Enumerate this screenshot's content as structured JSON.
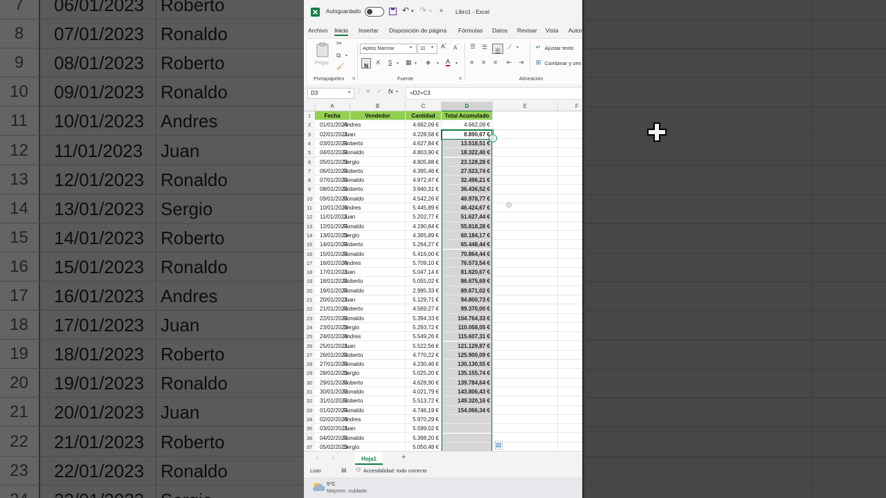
{
  "background": {
    "rows": [
      {
        "n": "7",
        "date": "06/01/2023",
        "name": "Roberto"
      },
      {
        "n": "8",
        "date": "07/01/2023",
        "name": "Ronaldo"
      },
      {
        "n": "9",
        "date": "08/01/2023",
        "name": "Roberto"
      },
      {
        "n": "10",
        "date": "09/01/2023",
        "name": "Ronaldo"
      },
      {
        "n": "11",
        "date": "10/01/2023",
        "name": "Andres"
      },
      {
        "n": "12",
        "date": "11/01/2023",
        "name": "Juan"
      },
      {
        "n": "13",
        "date": "12/01/2023",
        "name": "Ronaldo"
      },
      {
        "n": "14",
        "date": "13/01/2023",
        "name": "Sergio"
      },
      {
        "n": "15",
        "date": "14/01/2023",
        "name": "Roberto"
      },
      {
        "n": "16",
        "date": "15/01/2023",
        "name": "Ronaldo"
      },
      {
        "n": "17",
        "date": "16/01/2023",
        "name": "Andres"
      },
      {
        "n": "18",
        "date": "17/01/2023",
        "name": "Juan"
      },
      {
        "n": "19",
        "date": "18/01/2023",
        "name": "Roberto"
      },
      {
        "n": "20",
        "date": "19/01/2023",
        "name": "Ronaldo"
      },
      {
        "n": "21",
        "date": "20/01/2023",
        "name": "Juan"
      },
      {
        "n": "22",
        "date": "21/01/2023",
        "name": "Roberto"
      },
      {
        "n": "23",
        "date": "22/01/2023",
        "name": "Ronaldo"
      },
      {
        "n": "24",
        "date": "23/01/2023",
        "name": "Sergio"
      }
    ]
  },
  "titlebar": {
    "autosave_label": "Autoguardado",
    "doc_title": "Libro1  -  Excel"
  },
  "tabs": [
    "Archivo",
    "Inicio",
    "Insertar",
    "Disposición de página",
    "Fórmulas",
    "Datos",
    "Revisar",
    "Vista",
    "Autom"
  ],
  "active_tab": "Inicio",
  "ribbon": {
    "paste_label": "Pegar",
    "clipboard_group": "Portapapeles",
    "font_name": "Aptos Narrow",
    "font_size": "11",
    "bold": "N",
    "italic": "K",
    "underline": "S",
    "font_group": "Fuente",
    "wrap_text": "Ajustar texto",
    "merge": "Combinar y cen",
    "alignment_group": "Alineación"
  },
  "formula_bar": {
    "name_box": "D3",
    "fx": "fx",
    "formula": "=D2+C3"
  },
  "columns": [
    "A",
    "B",
    "C",
    "D",
    "E",
    "F"
  ],
  "headers": [
    "Fecha",
    "Vendedor",
    "Cantidad",
    "Total Acumulado"
  ],
  "rows": [
    [
      "01/01/2023",
      "Andres",
      "4.662,09 €",
      "4.662,09 €"
    ],
    [
      "02/01/2023",
      "Juan",
      "4.228,58 €",
      "8.890,67 €"
    ],
    [
      "03/01/2023",
      "Roberto",
      "4.627,84 €",
      "13.518,51 €"
    ],
    [
      "04/01/2023",
      "Ronaldo",
      "4.803,90 €",
      "18.322,40 €"
    ],
    [
      "05/01/2023",
      "Sergio",
      "4.805,88 €",
      "23.128,28 €"
    ],
    [
      "06/01/2023",
      "Roberto",
      "4.395,46 €",
      "27.523,74 €"
    ],
    [
      "07/01/2023",
      "Ronaldo",
      "4.972,47 €",
      "32.496,21 €"
    ],
    [
      "08/01/2023",
      "Roberto",
      "3.940,31 €",
      "36.436,52 €"
    ],
    [
      "09/01/2023",
      "Ronaldo",
      "4.542,26 €",
      "40.978,77 €"
    ],
    [
      "10/01/2023",
      "Andres",
      "5.445,89 €",
      "46.424,67 €"
    ],
    [
      "11/01/2023",
      "Juan",
      "5.202,77 €",
      "51.627,44 €"
    ],
    [
      "12/01/2023",
      "Ronaldo",
      "4.190,84 €",
      "55.818,28 €"
    ],
    [
      "13/01/2023",
      "Sergio",
      "4.365,89 €",
      "60.184,17 €"
    ],
    [
      "14/01/2023",
      "Roberto",
      "5.264,27 €",
      "65.448,44 €"
    ],
    [
      "15/01/2023",
      "Ronaldo",
      "5.416,00 €",
      "70.864,44 €"
    ],
    [
      "16/01/2023",
      "Andres",
      "5.709,10 €",
      "76.573,54 €"
    ],
    [
      "17/01/2023",
      "Juan",
      "5.047,14 €",
      "81.620,67 €"
    ],
    [
      "18/01/2023",
      "Roberto",
      "5.055,02 €",
      "86.675,69 €"
    ],
    [
      "19/01/2023",
      "Ronaldo",
      "2.995,33 €",
      "89.671,02 €"
    ],
    [
      "20/01/2023",
      "Juan",
      "5.129,71 €",
      "94.800,73 €"
    ],
    [
      "21/01/2023",
      "Roberto",
      "4.569,27 €",
      "99.370,00 €"
    ],
    [
      "22/01/2023",
      "Ronaldo",
      "5.394,33 €",
      "104.764,33 €"
    ],
    [
      "23/01/2023",
      "Sergio",
      "5.293,72 €",
      "110.058,05 €"
    ],
    [
      "24/01/2023",
      "Andres",
      "5.549,26 €",
      "115.607,31 €"
    ],
    [
      "25/01/2023",
      "Juan",
      "5.522,56 €",
      "121.129,87 €"
    ],
    [
      "26/01/2023",
      "Roberto",
      "4.770,22 €",
      "125.900,09 €"
    ],
    [
      "27/01/2023",
      "Ronaldo",
      "4.230,46 €",
      "130.130,55 €"
    ],
    [
      "28/01/2023",
      "Sergio",
      "5.025,20 €",
      "135.155,74 €"
    ],
    [
      "29/01/2023",
      "Roberto",
      "4.628,90 €",
      "139.784,64 €"
    ],
    [
      "30/01/2023",
      "Ronaldo",
      "4.021,79 €",
      "143.806,43 €"
    ],
    [
      "31/01/2023",
      "Roberto",
      "5.513,72 €",
      "149.320,16 €"
    ],
    [
      "01/02/2023",
      "Ronaldo",
      "4.746,19 €",
      "154.066,34 €"
    ],
    [
      "02/02/2023",
      "Andres",
      "5.970,29 €",
      ""
    ],
    [
      "03/02/2023",
      "Juan",
      "5.599,02 €",
      ""
    ],
    [
      "04/02/2023",
      "Ronaldo",
      "5.398,20 €",
      ""
    ],
    [
      "05/02/2023",
      "Sergio",
      "5.050,48 €",
      ""
    ]
  ],
  "sheet_tab": "Hoja1",
  "status": {
    "ready": "Listo",
    "accessibility": "Accesibilidad: todo correcto"
  },
  "weather": {
    "temp": "5°C",
    "desc": "Mayorm. nublado"
  },
  "colors": {
    "header_green": "#92d050",
    "fill_gray": "#d6d6d6",
    "excel_green": "#107c41"
  }
}
